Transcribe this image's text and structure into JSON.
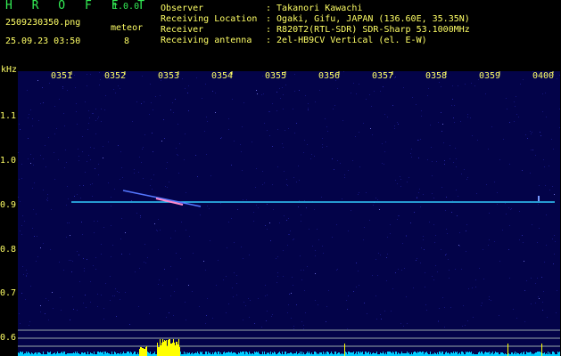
{
  "header": {
    "app_title": "H R O F F T",
    "app_version": "1.0.0",
    "file_name": "2509230350.png",
    "timestamp": "25.09.23 03:50",
    "meteor_label": "meteor",
    "meteor_count": "8",
    "info": [
      {
        "key": "Observer",
        "value": ": Takanori Kawachi"
      },
      {
        "key": "Receiving Location",
        "value": ": Ogaki, Gifu, JAPAN (136.60E, 35.35N)"
      },
      {
        "key": "Receiver",
        "value": ": R820T2(RTL-SDR) SDR-Sharp 53.1000MHz"
      },
      {
        "key": "Receiving antenna",
        "value": ": 2el-HB9CV Vertical (el. E-W)"
      }
    ]
  },
  "plot": {
    "y_unit": "kHz",
    "y_ticks": [
      "1.1",
      "1.0",
      "0.9",
      "0.8",
      "0.7",
      "0.6"
    ],
    "x_ticks": [
      "0351",
      "0352",
      "0353",
      "0354",
      "0355",
      "0356",
      "0357",
      "0358",
      "0359",
      "0400"
    ],
    "colors": {
      "background": "#030349",
      "carrier": "#33ccff",
      "label": "#ffff66",
      "spectrum": "#00ccff",
      "spectrum_peak": "#ffff00"
    }
  }
}
